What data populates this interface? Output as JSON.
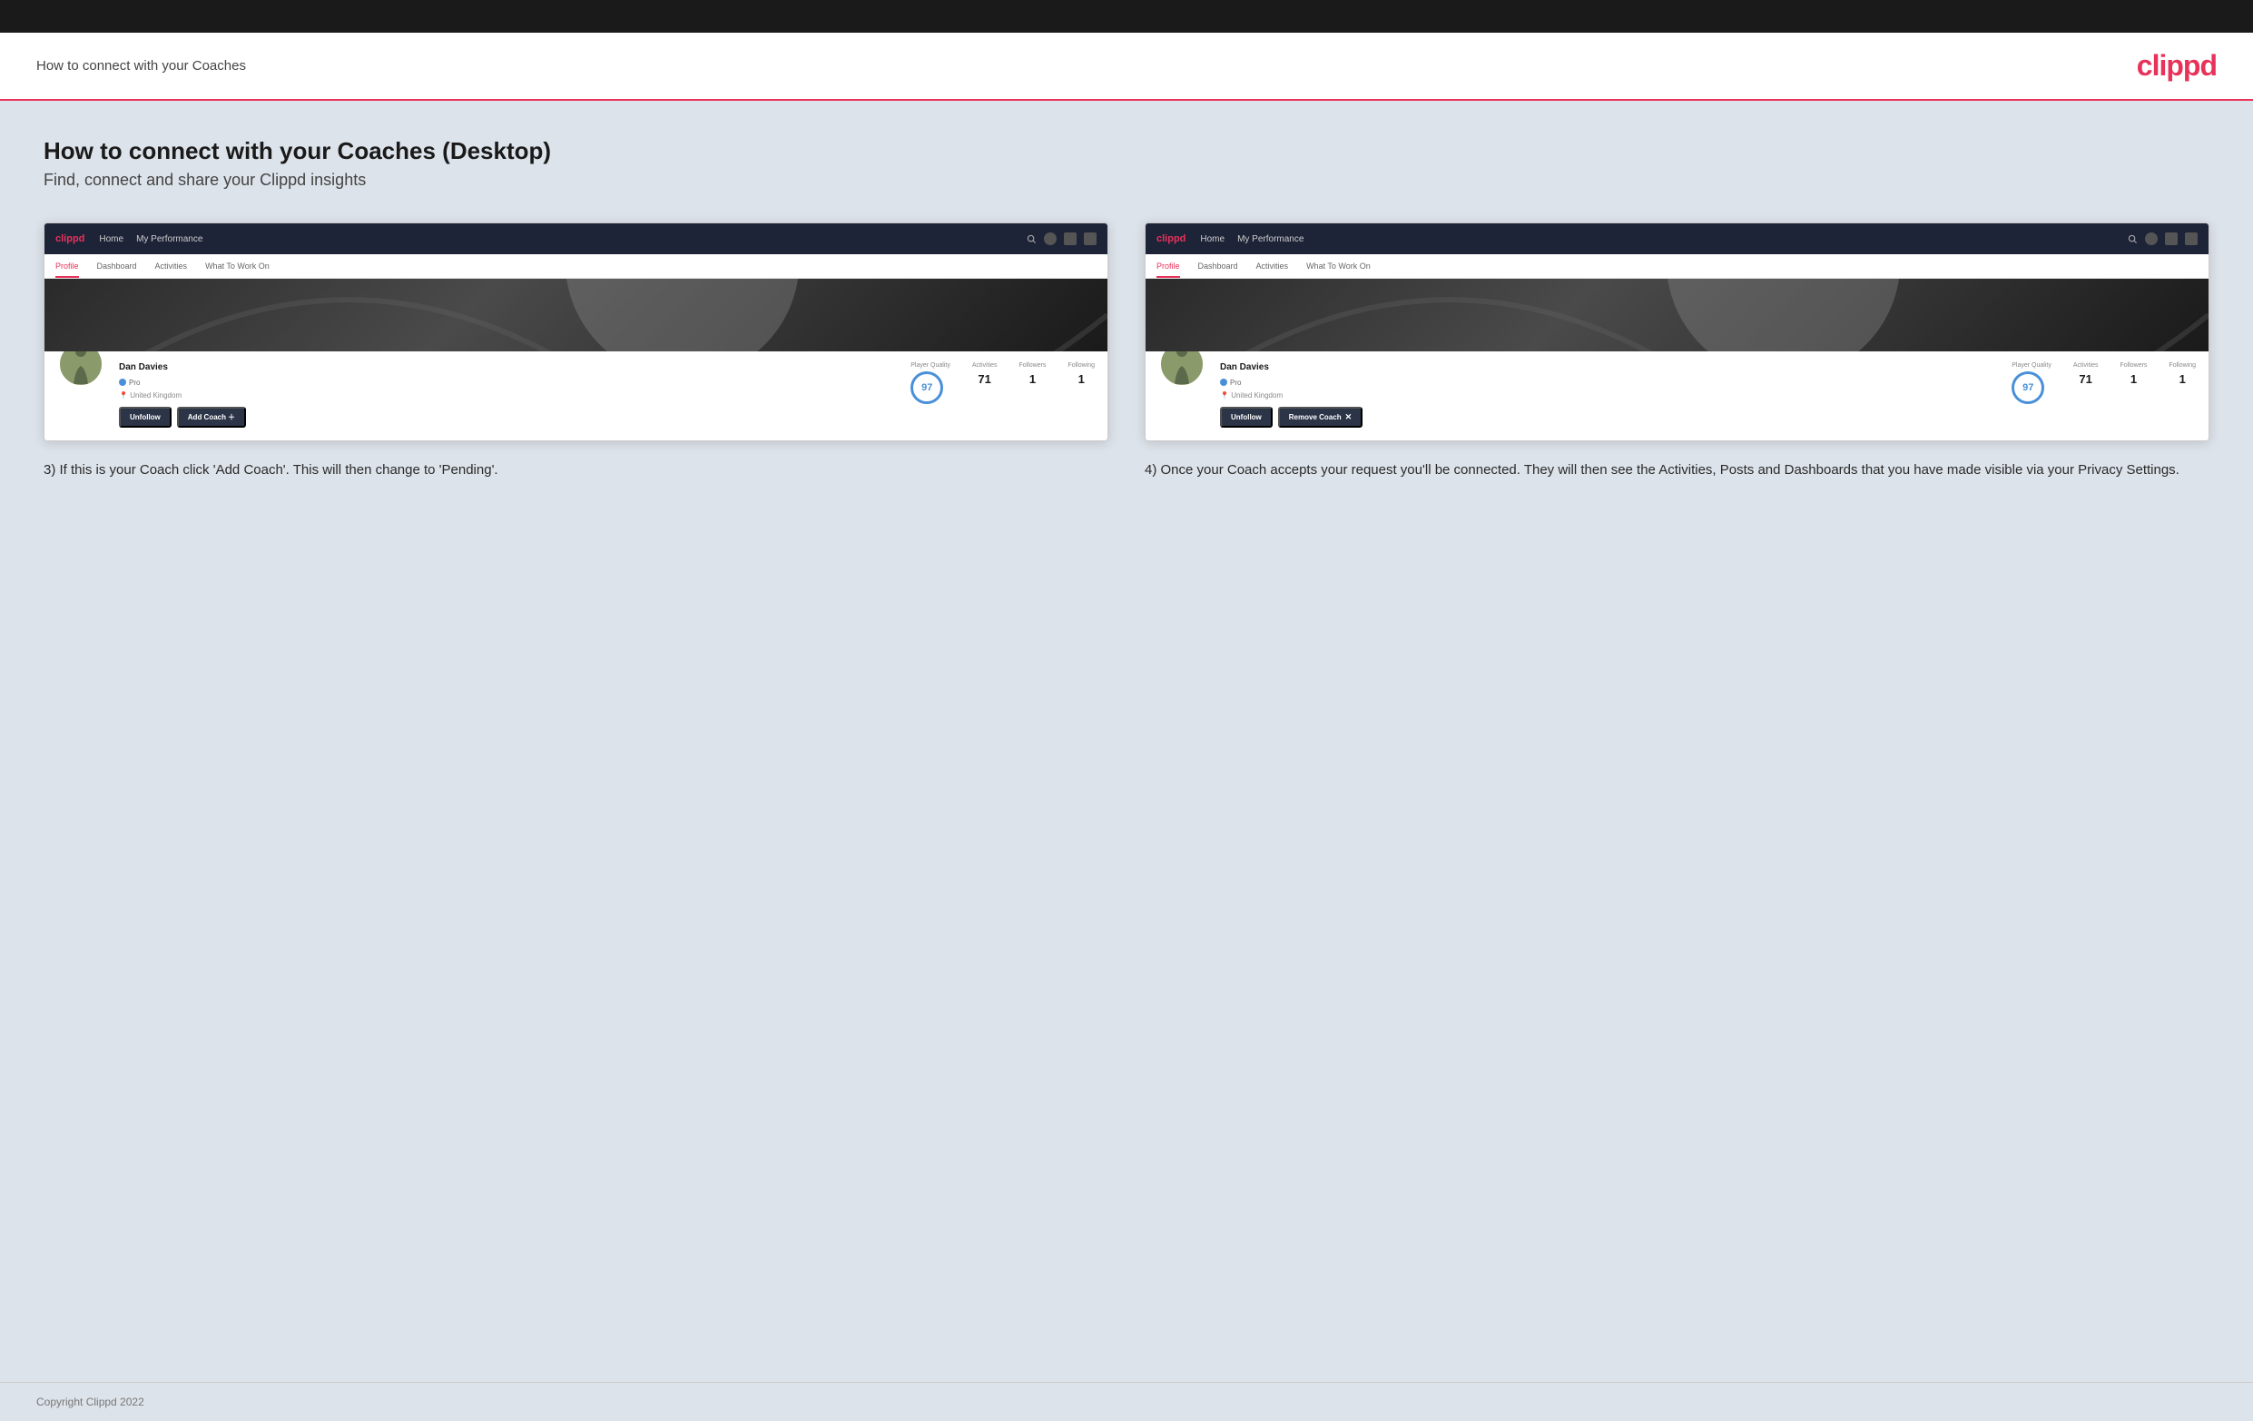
{
  "header": {
    "title": "How to connect with your Coaches",
    "logo": "clippd"
  },
  "page": {
    "heading": "How to connect with your Coaches (Desktop)",
    "subheading": "Find, connect and share your Clippd insights"
  },
  "left_column": {
    "mockup": {
      "navbar": {
        "logo": "clippd",
        "nav_items": [
          "Home",
          "My Performance"
        ],
        "icons": [
          "search",
          "person",
          "settings",
          "globe"
        ]
      },
      "tabs": [
        "Profile",
        "Dashboard",
        "Activities",
        "What To Work On"
      ],
      "active_tab": "Profile",
      "player_name": "Dan Davies",
      "badge": "Pro",
      "location": "United Kingdom",
      "stats": {
        "player_quality_label": "Player Quality",
        "player_quality_value": "97",
        "activities_label": "Activities",
        "activities_value": "71",
        "followers_label": "Followers",
        "followers_value": "1",
        "following_label": "Following",
        "following_value": "1"
      },
      "buttons": [
        "Unfollow",
        "Add Coach"
      ]
    },
    "description": "3) If this is your Coach click 'Add Coach'. This will then change to 'Pending'."
  },
  "right_column": {
    "mockup": {
      "navbar": {
        "logo": "clippd",
        "nav_items": [
          "Home",
          "My Performance"
        ],
        "icons": [
          "search",
          "person",
          "settings",
          "globe"
        ]
      },
      "tabs": [
        "Profile",
        "Dashboard",
        "Activities",
        "What To Work On"
      ],
      "active_tab": "Profile",
      "player_name": "Dan Davies",
      "badge": "Pro",
      "location": "United Kingdom",
      "stats": {
        "player_quality_label": "Player Quality",
        "player_quality_value": "97",
        "activities_label": "Activities",
        "activities_value": "71",
        "followers_label": "Followers",
        "followers_value": "1",
        "following_label": "Following",
        "following_value": "1"
      },
      "buttons": [
        "Unfollow",
        "Remove Coach"
      ]
    },
    "description": "4) Once your Coach accepts your request you'll be connected. They will then see the Activities, Posts and Dashboards that you have made visible via your Privacy Settings."
  },
  "footer": {
    "copyright": "Copyright Clippd 2022"
  }
}
